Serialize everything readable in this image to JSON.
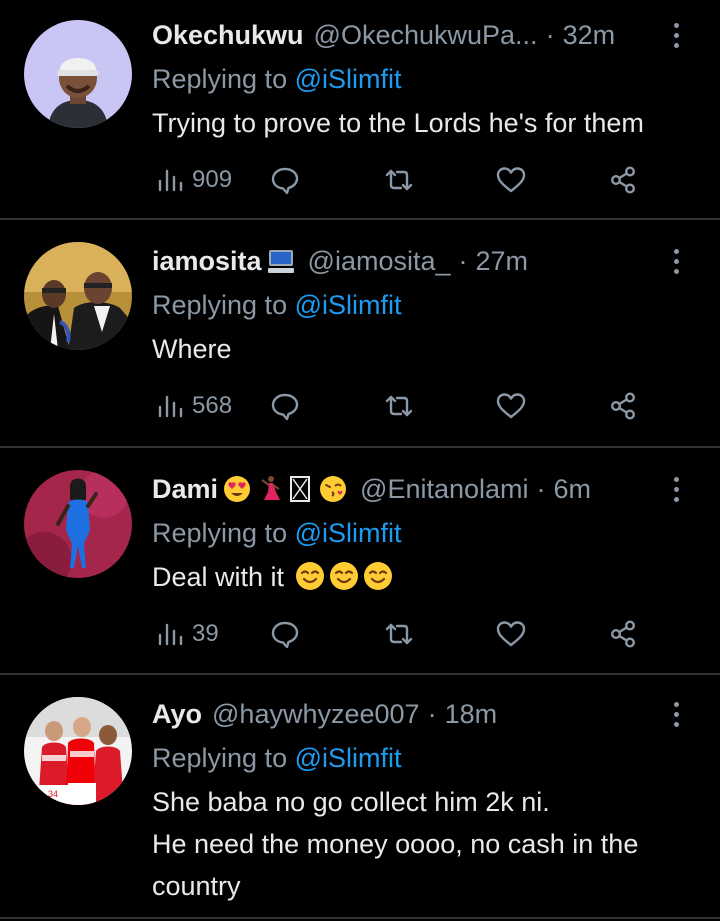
{
  "tweets": [
    {
      "name": "Okechukwu",
      "handle": "@OkechukwuPa...",
      "time": "32m",
      "replying_prefix": "Replying to ",
      "replying_to": "@iSlimfit",
      "text": "Trying to prove to the Lords he's for them",
      "views": "909",
      "emoji_suffix": ""
    },
    {
      "name": "iamosita",
      "handle": "@iamosita_",
      "time": "27m",
      "replying_prefix": "Replying to ",
      "replying_to": "@iSlimfit",
      "text": "Where",
      "views": "568",
      "emoji_suffix": ""
    },
    {
      "name": "Dami",
      "handle": "@Enitanolami",
      "time": "6m",
      "replying_prefix": "Replying to ",
      "replying_to": "@iSlimfit",
      "text": "Deal with it",
      "views": "39",
      "emoji_suffix": "😊😊😊"
    },
    {
      "name": "Ayo",
      "handle": "@haywhyzee007",
      "time": "18m",
      "replying_prefix": "Replying to ",
      "replying_to": "@iSlimfit",
      "text": "She baba no go collect him 2k ni.\nHe need the money oooo, no cash in the country",
      "views": "",
      "emoji_suffix": ""
    }
  ],
  "separator_dot": "·",
  "icons": {
    "views": "views-bar-icon",
    "reply": "reply-bubble-icon",
    "retweet": "retweet-icon",
    "like": "heart-icon",
    "share": "share-icon",
    "more": "more-vertical-icon"
  },
  "colors": {
    "background": "#000000",
    "text": "#e7e9ea",
    "secondary": "#8b98a5",
    "link": "#1d9bf0",
    "divider": "#2f3336"
  }
}
